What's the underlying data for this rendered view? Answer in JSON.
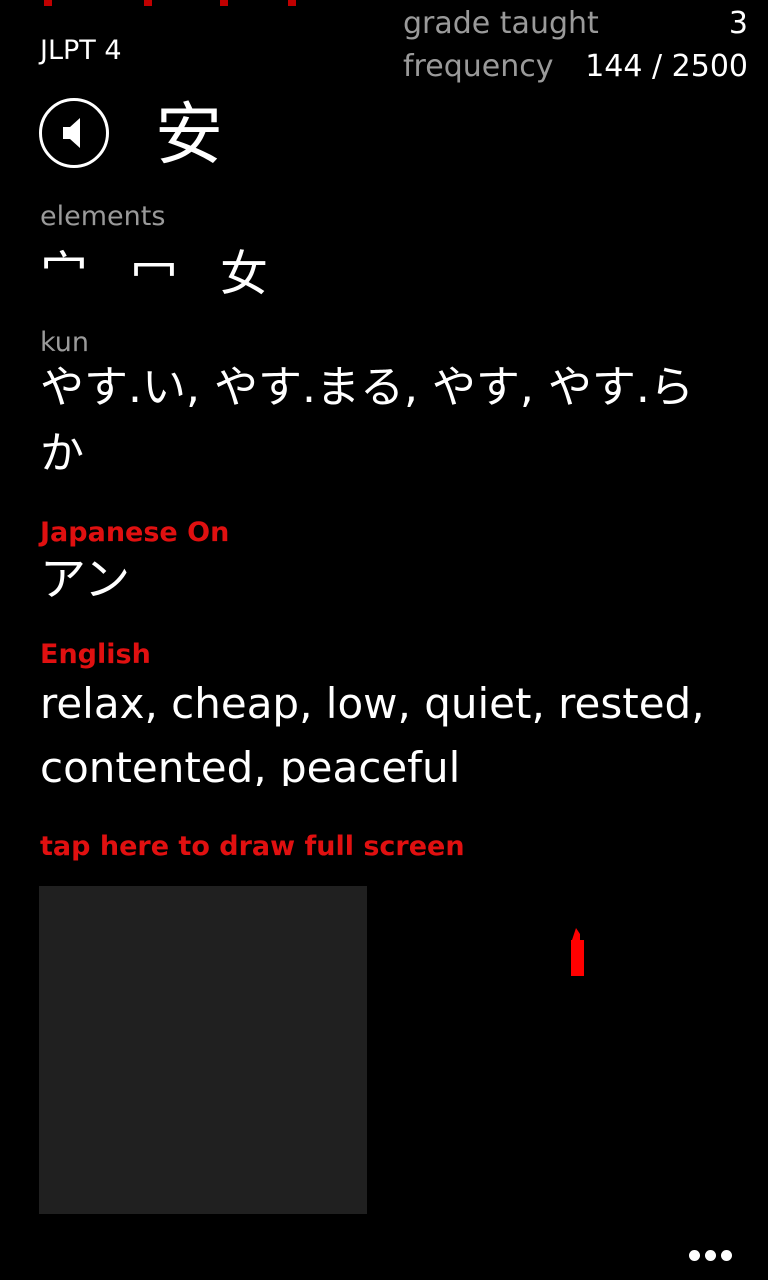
{
  "header": {
    "jlpt": "JLPT 4",
    "grade_label": "grade taught",
    "grade_value": "3",
    "frequency_label": "frequency",
    "frequency_value": "144 / 2500"
  },
  "kanji": {
    "character": "安",
    "sound_icon": "speaker-icon"
  },
  "elements": {
    "label": "elements",
    "items": [
      "宀",
      "冖",
      "女"
    ]
  },
  "kun": {
    "label": "kun",
    "readings": "やす.い, やす.まる, やす, やす.らか"
  },
  "on": {
    "label": "Japanese On",
    "readings": "アン"
  },
  "english": {
    "label": "English",
    "meanings": "relax, cheap, low, quiet, rested, contented, peaceful"
  },
  "drawing": {
    "link_label": "tap here to draw full screen",
    "brush_icon": "brush-icon"
  },
  "app_bar": {
    "more_icon": "ellipsis-icon"
  },
  "colors": {
    "accent": "#e01010",
    "muted": "#9a9a9a",
    "background": "#000000",
    "pad": "#202020"
  }
}
